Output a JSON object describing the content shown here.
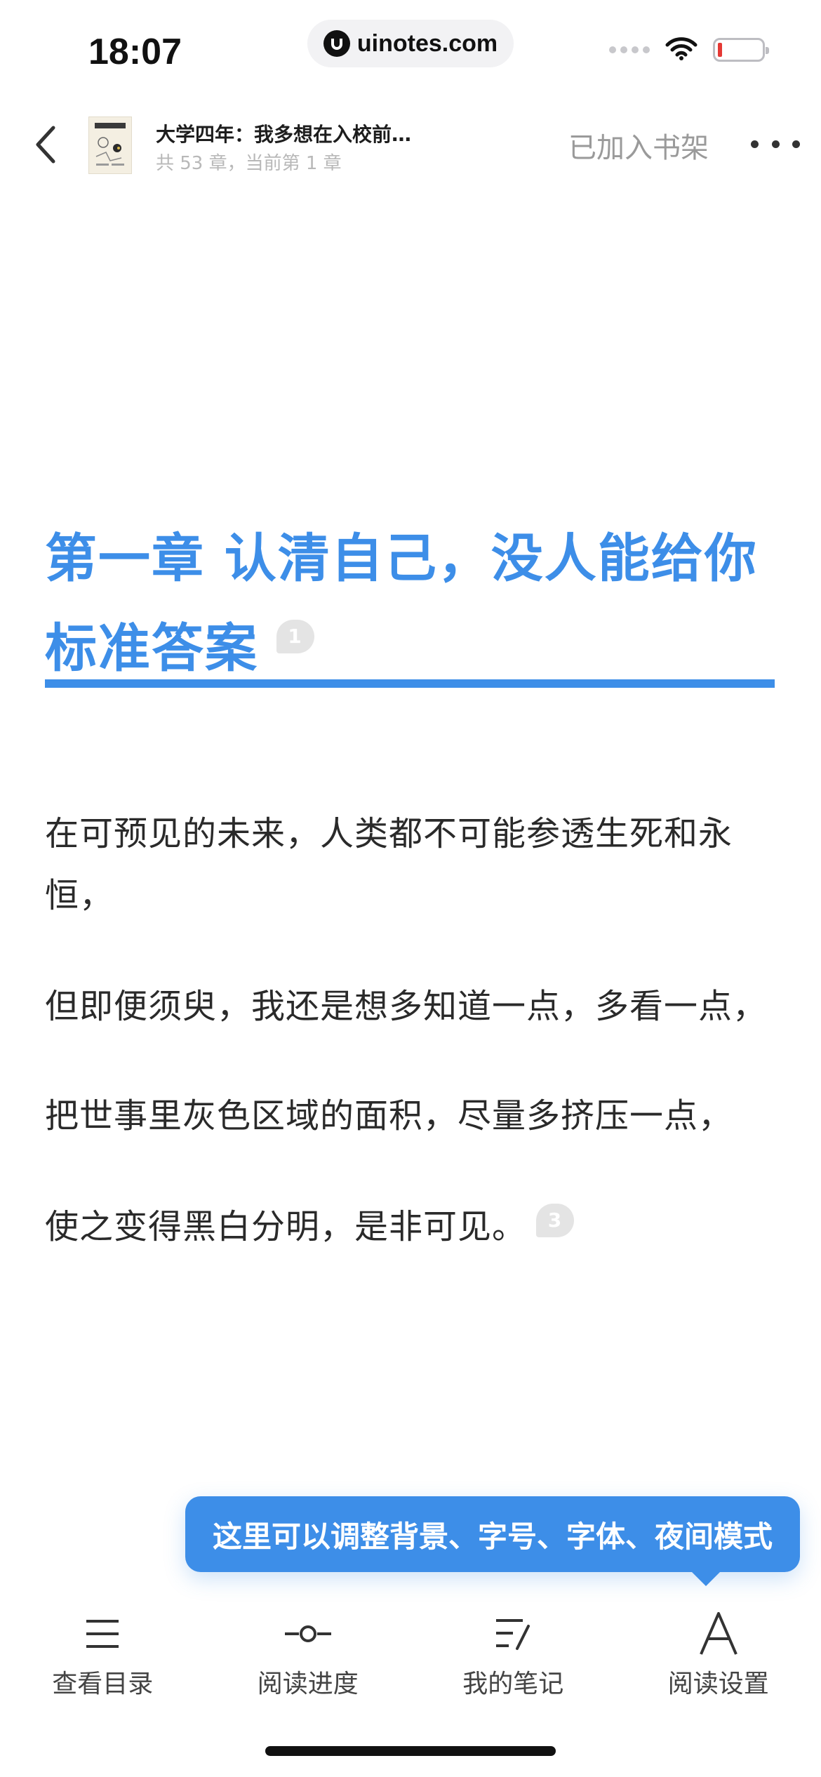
{
  "status_bar": {
    "time": "18:07",
    "url": "uinotes.com"
  },
  "header": {
    "book_title": "大学四年：我多想在入校前…",
    "book_progress": "共 53 章，当前第 1 章",
    "shelf_label": "已加入书架"
  },
  "chapter": {
    "title_line1": "第一章 认清自己，没人能给你",
    "title_line2": "标准答案",
    "title_note_count": "1"
  },
  "paragraphs": [
    {
      "text": "在可预见的未来，人类都不可能参透生死和永恒，"
    },
    {
      "text": "但即便须臾，我还是想多知道一点，多看一点，"
    },
    {
      "text": "把世事里灰色区域的面积，尽量多挤压一点，"
    },
    {
      "text": "使之变得黑白分明，是非可见。",
      "note_count": "3"
    }
  ],
  "tooltip": {
    "text": "这里可以调整背景、字号、字体、夜间模式"
  },
  "toolbar": {
    "items": [
      {
        "label": "查看目录",
        "icon": "menu-list-icon"
      },
      {
        "label": "阅读进度",
        "icon": "progress-slider-icon"
      },
      {
        "label": "我的笔记",
        "icon": "notes-icon"
      },
      {
        "label": "阅读设置",
        "icon": "font-settings-icon"
      }
    ]
  },
  "colors": {
    "accent": "#3d8ee8",
    "battery_low": "#e53935"
  }
}
